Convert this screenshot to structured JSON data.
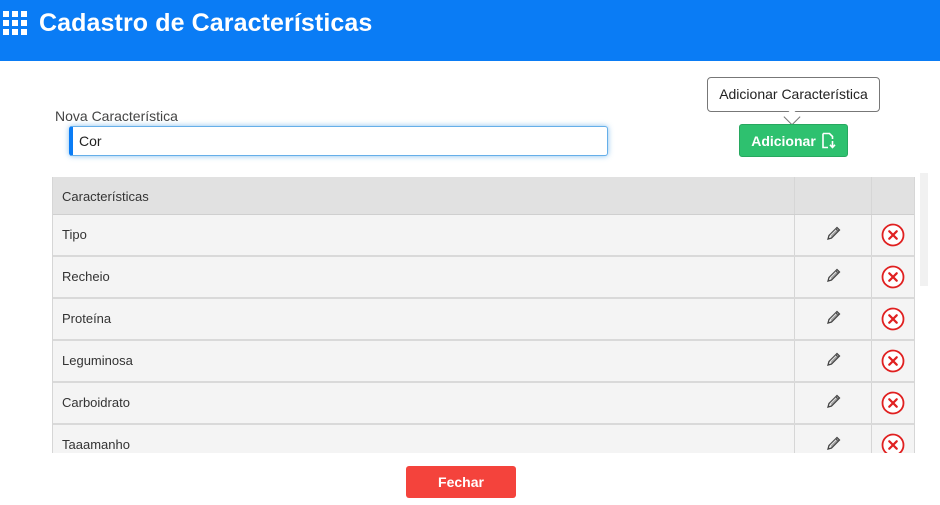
{
  "header": {
    "title": "Cadastro de Características",
    "icon": "apps-grid-icon"
  },
  "form": {
    "label": "Nova Característica",
    "value": "Cor",
    "add_button_label": "Adicionar",
    "add_icon": "file-arrow-icon",
    "tooltip": "Adicionar Característica"
  },
  "table": {
    "header": "Características",
    "rows": [
      "Tipo",
      "Recheio",
      "Proteína",
      "Leguminosa",
      "Carboidrato",
      "Taaamanho"
    ]
  },
  "footer": {
    "close_label": "Fechar"
  },
  "colors": {
    "header": "#0a7cf5",
    "add_button": "#2ec16f",
    "close_button": "#f4433c",
    "delete": "#e02020"
  }
}
